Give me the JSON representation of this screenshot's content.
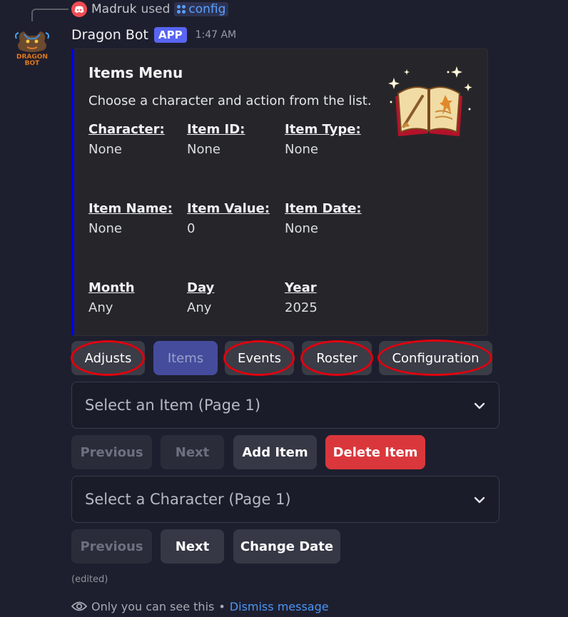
{
  "reply": {
    "user": "Madruk",
    "used_text": "used",
    "command": "config"
  },
  "message": {
    "bot_name": "Dragon Bot",
    "badge": "APP",
    "timestamp": "1:47 AM"
  },
  "embed": {
    "accent_color": "#0000ee",
    "title": "Items Menu",
    "description": "Choose a character and action from the list.",
    "fields": [
      {
        "name": "Character:",
        "value": "None"
      },
      {
        "name": "Item ID:",
        "value": "None"
      },
      {
        "name": "Item Type:",
        "value": "None"
      },
      {
        "name": "Item Name:",
        "value": "None"
      },
      {
        "name": "Item Value:",
        "value": "0"
      },
      {
        "name": "Item Date:",
        "value": "None"
      },
      {
        "name": "Month",
        "value": "Any"
      },
      {
        "name": "Day",
        "value": "Any"
      },
      {
        "name": "Year",
        "value": "2025"
      }
    ]
  },
  "nav_buttons": [
    {
      "label": "Adjusts",
      "active": false,
      "highlighted": true
    },
    {
      "label": "Items",
      "active": true,
      "highlighted": false
    },
    {
      "label": "Events",
      "active": false,
      "highlighted": true
    },
    {
      "label": "Roster",
      "active": false,
      "highlighted": true
    },
    {
      "label": "Configuration",
      "active": false,
      "highlighted": true
    }
  ],
  "item_select": {
    "placeholder": "Select an Item (Page 1)"
  },
  "item_buttons": {
    "previous": "Previous",
    "next": "Next",
    "add": "Add Item",
    "delete": "Delete Item"
  },
  "character_select": {
    "placeholder": "Select a Character (Page 1)"
  },
  "character_buttons": {
    "previous": "Previous",
    "next": "Next",
    "change_date": "Change Date"
  },
  "edited_label": "(edited)",
  "ephemeral": {
    "notice": "Only you can see this",
    "separator": "•",
    "dismiss": "Dismiss message"
  },
  "colors": {
    "primary_button": "#5865f2",
    "danger_button": "#da373c",
    "highlight_circle": "#e0000f",
    "link": "#4c95f5"
  }
}
